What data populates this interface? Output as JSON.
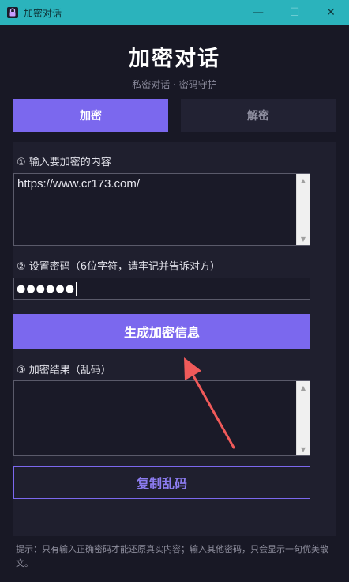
{
  "window": {
    "title": "加密对话",
    "controls": {
      "minimize": "—",
      "maximize": "☐",
      "close": "✕"
    }
  },
  "header": {
    "title": "加密对话",
    "subtitle": "私密对话 · 密码守护"
  },
  "tabs": [
    {
      "label": "加密",
      "active": true
    },
    {
      "label": "解密",
      "active": false
    }
  ],
  "form": {
    "step1_label": "① 输入要加密的内容",
    "content_value": "https://www.cr173.com/",
    "step2_label": "② 设置密码（6位字符，请牢记并告诉对方）",
    "password_masked": "●●●●●●",
    "generate_label": "生成加密信息",
    "step3_label": "③ 加密结果（乱码）",
    "result_value": "",
    "copy_label": "复制乱码"
  },
  "hint": "提示：只有输入正确密码才能还原真实内容；输入其他密码，只会显示一句优美散文。",
  "colors": {
    "accent": "#7b68ee",
    "titlebar": "#2bb3bc",
    "background": "#181825",
    "annotation_arrow": "#f05a5a"
  },
  "icons": {
    "app": "lock-icon",
    "scroll_up": "triangle-up-icon",
    "scroll_down": "triangle-down-icon"
  }
}
